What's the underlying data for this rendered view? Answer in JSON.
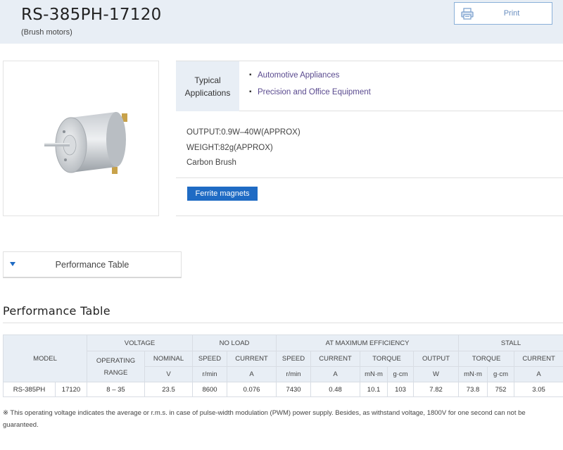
{
  "header": {
    "title": "RS-385PH-17120",
    "subtitle": "(Brush motors)",
    "print_label": "Print"
  },
  "applications": {
    "label_line1": "Typical",
    "label_line2": "Applications",
    "items": [
      "Automotive Appliances",
      "Precision and Office Equipment"
    ]
  },
  "specs": {
    "output": "OUTPUT:0.9W–40W(APPROX)",
    "weight": "WEIGHT:82g(APPROX)",
    "brush": "Carbon Brush"
  },
  "magnet_badge": "Ferrite magnets",
  "perf_tab_label": "Performance Table",
  "section_title": "Performance Table",
  "table": {
    "groups": {
      "model": "MODEL",
      "voltage": "VOLTAGE",
      "no_load": "NO LOAD",
      "max_eff": "AT MAXIMUM EFFICIENCY",
      "stall": "STALL"
    },
    "subheads": {
      "operating_range_1": "OPERATING",
      "operating_range_2": "RANGE",
      "nominal": "NOMINAL",
      "speed": "SPEED",
      "current": "CURRENT",
      "torque": "TORQUE",
      "output": "OUTPUT"
    },
    "units": {
      "nominal": "V",
      "nl_speed": "r/min",
      "nl_current": "A",
      "me_speed": "r/min",
      "me_current": "A",
      "me_torque_mnm": "mN·m",
      "me_torque_gcm": "g·cm",
      "me_output": "W",
      "st_torque_mnm": "mN·m",
      "st_torque_gcm": "g·cm",
      "st_current": "A"
    },
    "row": {
      "model": "RS-385PH",
      "variant": "17120",
      "operating_range": "8 – 35",
      "nominal": "23.5",
      "nl_speed": "8600",
      "nl_current": "0.076",
      "me_speed": "7430",
      "me_current": "0.48",
      "me_torque_mnm": "10.1",
      "me_torque_gcm": "103",
      "me_output": "7.82",
      "st_torque_mnm": "73.8",
      "st_torque_gcm": "752",
      "st_current": "3.05"
    }
  },
  "note": "※  This operating voltage indicates the average or r.m.s. in case of pulse-width modulation (PWM) power supply. Besides, as withstand voltage, 1800V for one second can not be guaranteed.",
  "icons": {
    "print": "printer-icon",
    "tab_arrow": "triangle-down-icon",
    "bullet": "bullet-icon",
    "product": "motor-photo"
  },
  "colors": {
    "header_bg": "#e8eef5",
    "accent": "#1f6bc4",
    "link": "#5a4a8f"
  }
}
